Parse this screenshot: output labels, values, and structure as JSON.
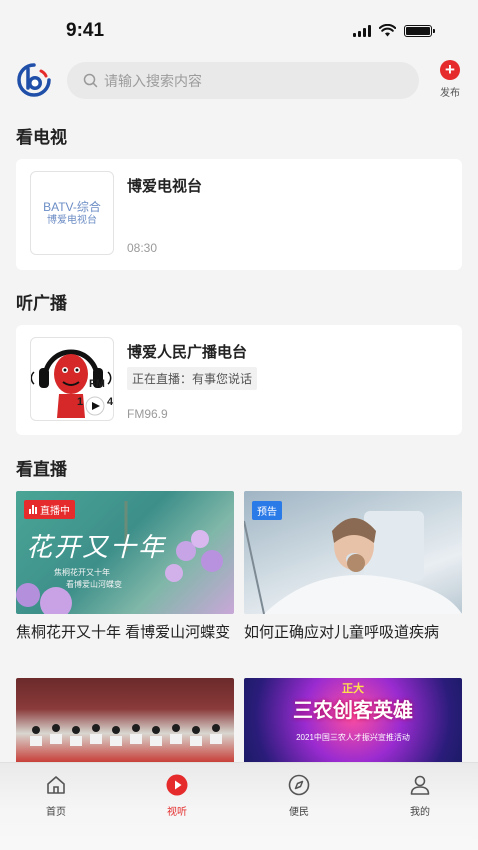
{
  "status_bar": {
    "time": "9:41"
  },
  "header": {
    "search_placeholder": "请输入搜索内容",
    "publish_label": "发布"
  },
  "tv": {
    "section_title": "看电视",
    "channel": {
      "name": "博爱电视台",
      "time": "08:30",
      "logo_line1": "BATV-综合",
      "logo_line2": "博爱电视台"
    }
  },
  "radio": {
    "section_title": "听广播",
    "station": {
      "name": "博爱人民广播电台",
      "now_playing": "正在直播：有事您说话",
      "frequency": "FM96.9",
      "logo_fm": "FM",
      "logo_num_left": "1",
      "logo_num_right": "4"
    }
  },
  "live": {
    "section_title": "看直播",
    "videos": [
      {
        "badge": "直播中",
        "title": "焦桐花开又十年 看博爱山河蝶变",
        "overlay_title": "花开又十年",
        "overlay_sub1": "焦桐花开又十年",
        "overlay_sub2": "看博爱山河蝶变"
      },
      {
        "badge": "预告",
        "title": "如何正确应对儿童呼吸道疾病"
      },
      {
        "title": ""
      },
      {
        "title": "",
        "overlay_top": "正大",
        "overlay_main": "三农创客英雄",
        "overlay_sub": "2021中国三农人才振兴宣推活动"
      }
    ]
  },
  "tabbar": {
    "tabs": [
      {
        "label": "首页",
        "icon": "home-icon"
      },
      {
        "label": "视听",
        "icon": "play-icon",
        "active": true
      },
      {
        "label": "便民",
        "icon": "compass-icon"
      },
      {
        "label": "我的",
        "icon": "user-icon"
      }
    ]
  },
  "colors": {
    "accent": "#e52b2b",
    "preview_badge": "#2a7ae8",
    "background": "#f4f4f4"
  }
}
